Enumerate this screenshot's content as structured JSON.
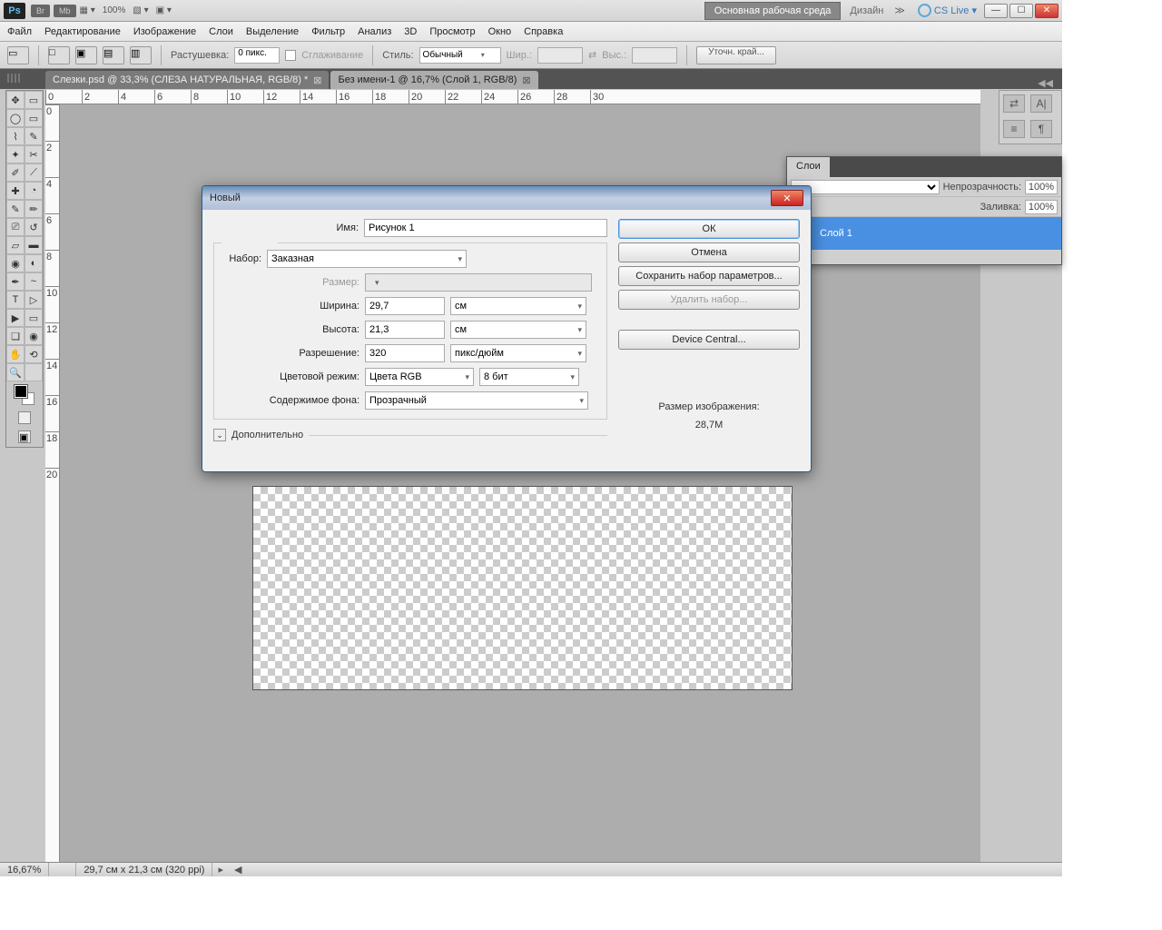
{
  "titlebar": {
    "logo": "Ps",
    "br": "Br",
    "mb": "Mb",
    "zoom": "100%",
    "workspace_btn": "Основная рабочая среда",
    "design": "Дизайн",
    "cslive": "CS Live ▾"
  },
  "menu": [
    "Файл",
    "Редактирование",
    "Изображение",
    "Слои",
    "Выделение",
    "Фильтр",
    "Анализ",
    "3D",
    "Просмотр",
    "Окно",
    "Справка"
  ],
  "options": {
    "feather_lbl": "Растушевка:",
    "feather_val": "0 пикс.",
    "antialias": "Сглаживание",
    "style_lbl": "Стиль:",
    "style_val": "Обычный",
    "width_lbl": "Шир.:",
    "height_lbl": "Выс.:",
    "refine": "Уточн. край..."
  },
  "tabs": {
    "t1": "Слезки.psd @ 33,3% (СЛЕЗА НАТУРАЛЬНАЯ, RGB/8) *",
    "t2": "Без имени-1 @ 16,7% (Слой 1, RGB/8)"
  },
  "layers": {
    "tab": "Слои",
    "opacity_lbl": "Непрозрачность:",
    "opacity_val": "100%",
    "fill_lbl": "Заливка:",
    "fill_val": "100%",
    "layer_name": "Слой 1"
  },
  "status": {
    "zoom": "16,67%",
    "dims": "29,7 см x 21,3 см (320 ppi)"
  },
  "dialog": {
    "title": "Новый",
    "name_lbl": "Имя:",
    "name_val": "Рисунок 1",
    "preset_lbl": "Набор:",
    "preset_val": "Заказная",
    "size_lbl": "Размер:",
    "width_lbl": "Ширина:",
    "width_val": "29,7",
    "width_unit": "см",
    "height_lbl": "Высота:",
    "height_val": "21,3",
    "height_unit": "см",
    "res_lbl": "Разрешение:",
    "res_val": "320",
    "res_unit": "пикс/дюйм",
    "mode_lbl": "Цветовой режим:",
    "mode_val": "Цвета RGB",
    "depth_val": "8 бит",
    "bg_lbl": "Содержимое фона:",
    "bg_val": "Прозрачный",
    "advanced": "Дополнительно",
    "ok": "ОК",
    "cancel": "Отмена",
    "save_preset": "Сохранить набор параметров...",
    "delete_preset": "Удалить набор...",
    "device_central": "Device Central...",
    "imgsize_lbl": "Размер изображения:",
    "imgsize_val": "28,7M"
  },
  "ruler_h": [
    "0",
    "2",
    "4",
    "6",
    "8",
    "10",
    "12",
    "14",
    "16",
    "18",
    "20",
    "22",
    "24",
    "26",
    "28",
    "30"
  ],
  "ruler_v": [
    "0",
    "2",
    "4",
    "6",
    "8",
    "10",
    "12",
    "14",
    "16",
    "18",
    "20"
  ],
  "panel_letters": {
    "a": "A|",
    "p": "¶"
  }
}
